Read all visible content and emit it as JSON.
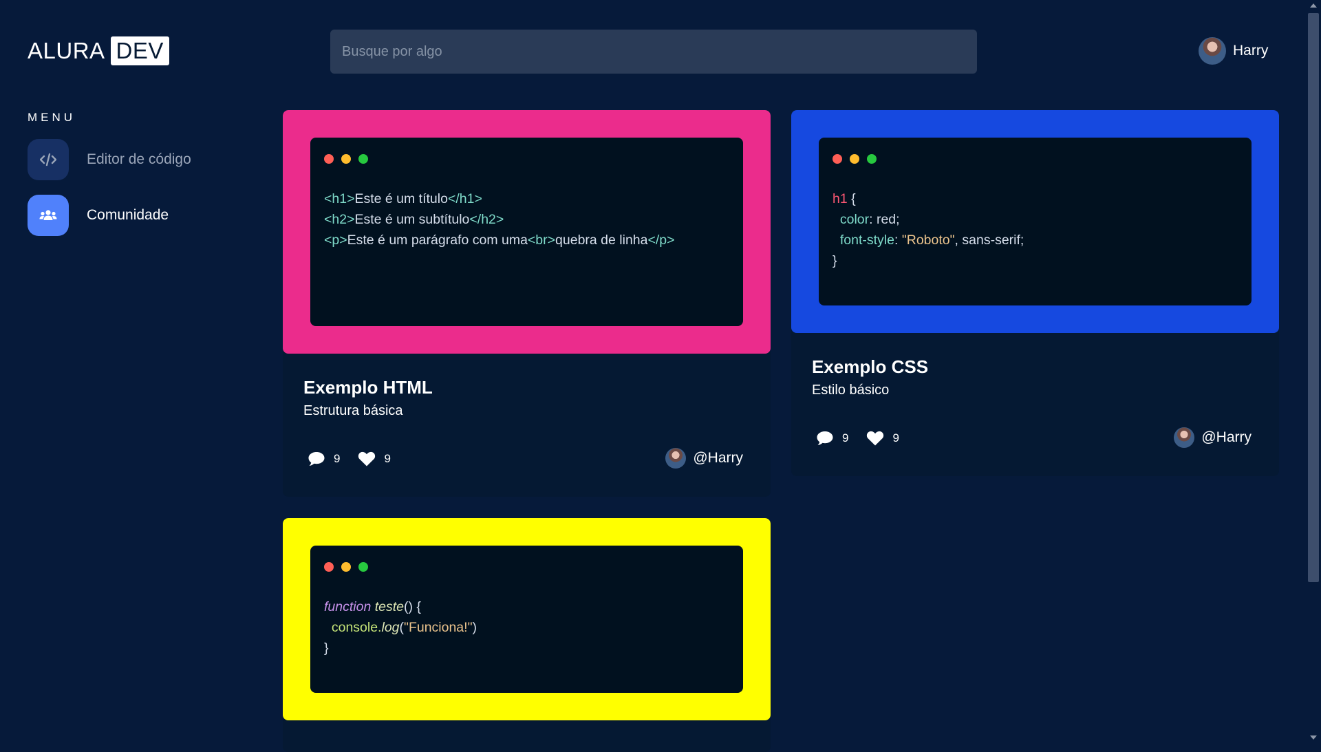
{
  "app": {
    "logo_text": "ALURA",
    "logo_badge": "DEV"
  },
  "search": {
    "placeholder": "Busque por algo",
    "value": ""
  },
  "user": {
    "name": "Harry"
  },
  "menu": {
    "title": "MENU",
    "items": [
      {
        "label": "Editor de código",
        "icon": "code-icon",
        "active": false
      },
      {
        "label": "Comunidade",
        "icon": "users-icon",
        "active": true
      }
    ]
  },
  "cards": [
    {
      "title": "Exemplo HTML",
      "subtitle": "Estrutura básica",
      "frame_color": "#eb2c8c",
      "comments": "9",
      "likes": "9",
      "author": "@Harry",
      "code": {
        "l1": {
          "open": "<h1>",
          "text": "Este é um título",
          "close": "</h1>"
        },
        "l2": {
          "open": "<h2>",
          "text": "Este é um subtítulo",
          "close": "</h2>"
        },
        "l3": {
          "open": "<p>",
          "text": "Este é um parágrafo com uma",
          "br": "<br>",
          "text2": "quebra de linha",
          "close": "</p>"
        }
      }
    },
    {
      "title": "Exemplo CSS",
      "subtitle": "Estilo básico",
      "frame_color": "#1649e0",
      "comments": "9",
      "likes": "9",
      "author": "@Harry",
      "code": {
        "selector": "h1",
        "brace_open": " {",
        "p1": "color",
        "v1": " red;",
        "p2": "font-style",
        "v2a": "\"Roboto\"",
        "v2b": ", sans-serif;",
        "brace_close": "}"
      }
    },
    {
      "frame_color": "#ffff00",
      "code": {
        "kw": "function",
        "fn": "teste",
        "sig": "() {",
        "obj": "console.",
        "method": "log",
        "paren_open": "(",
        "str": "\"Funciona!\"",
        "paren_close": ")",
        "brace_close": "}"
      }
    }
  ]
}
